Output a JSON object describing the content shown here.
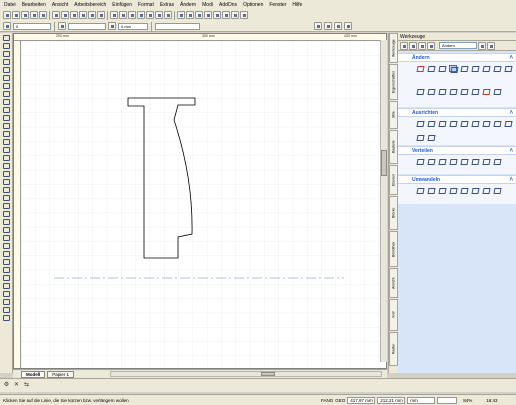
{
  "menu": [
    "Datei",
    "Bearbeiten",
    "Ansicht",
    "Arbeitsbereich",
    "Einfügen",
    "Format",
    "Extras",
    "Ändern",
    "Modi",
    "AddOns",
    "Optionen",
    "Fenster",
    "Hilfe"
  ],
  "toolbar": {
    "layer_field": "0",
    "width_field": "0 mm",
    "extra_field": ""
  },
  "ruler": {
    "top_labels": [
      "200 mm",
      "300 mm",
      "400 mm"
    ]
  },
  "tabs": {
    "model": "Modell",
    "layout": "Papier 1"
  },
  "right_strip_tabs": [
    "Werkzeuge",
    "Eigenschaften",
    "Stile",
    "Bauteile",
    "Ebenen",
    "Blöcke",
    "Bibliothek",
    "Ansicht",
    "Xref",
    "Raster"
  ],
  "panel": {
    "title": "Werkzeuge",
    "dropdown": "Ändern",
    "sections": [
      {
        "title": "Ändern",
        "toggle": "˄"
      },
      {
        "title": "Ausrichten",
        "toggle": "˄"
      },
      {
        "title": "Verteilen",
        "toggle": "˄"
      },
      {
        "title": "Umwandeln",
        "toggle": "˄"
      }
    ]
  },
  "status": {
    "message": "Klicken Sie auf die Linie, die Sie kürzen bzw. verlängern wollen",
    "fang": "FANG",
    "geo": "GEO",
    "x": "417,97 mm",
    "y": "212,21 mm",
    "field3": "mm",
    "zoom": "84%",
    "time": "16:43"
  },
  "colors": {
    "accent": "#215dc6",
    "panel_bg": "#d8e4f8",
    "grid": "#dfe6ee",
    "drawing": "#000000",
    "dashline": "#6a7fd0"
  }
}
